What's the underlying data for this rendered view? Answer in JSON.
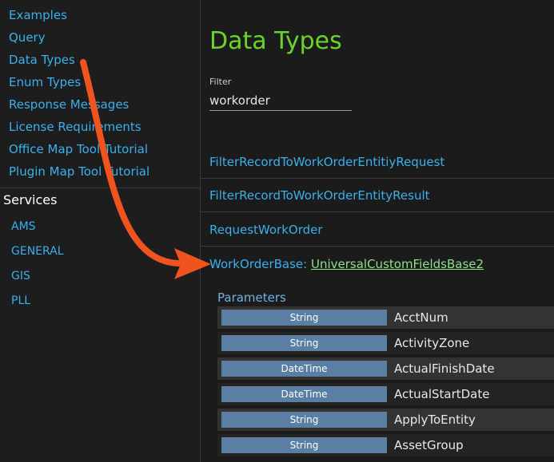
{
  "sidebar": {
    "items": [
      {
        "label": "Examples"
      },
      {
        "label": "Query"
      },
      {
        "label": "Data Types"
      },
      {
        "label": "Enum Types"
      },
      {
        "label": "Response Messages"
      },
      {
        "label": "License Requirements"
      },
      {
        "label": "Office Map Tool Tutorial"
      },
      {
        "label": "Plugin Map Tool Tutorial"
      }
    ],
    "services_heading": "Services",
    "services": [
      {
        "label": "AMS"
      },
      {
        "label": "GENERAL"
      },
      {
        "label": "GIS"
      },
      {
        "label": "PLL"
      }
    ]
  },
  "main": {
    "title": "Data Types",
    "filter": {
      "label": "Filter",
      "value": "workorder"
    },
    "types": [
      {
        "name": "FilterRecordToWorkOrderEntitiyRequest"
      },
      {
        "name": "FilterRecordToWorkOrderEntityResult"
      },
      {
        "name": "RequestWorkOrder"
      }
    ],
    "selected_type": {
      "name": "WorkOrderBase",
      "separator": ":",
      "base": "UniversalCustomFieldsBase2"
    },
    "parameters_heading": "Parameters",
    "parameters": [
      {
        "type": "String",
        "name": "AcctNum"
      },
      {
        "type": "String",
        "name": "ActivityZone"
      },
      {
        "type": "DateTime",
        "name": "ActualFinishDate"
      },
      {
        "type": "DateTime",
        "name": "ActualStartDate"
      },
      {
        "type": "String",
        "name": "ApplyToEntity"
      },
      {
        "type": "String",
        "name": "AssetGroup"
      }
    ]
  },
  "annotation": {
    "arrow_color": "#f0531e"
  }
}
